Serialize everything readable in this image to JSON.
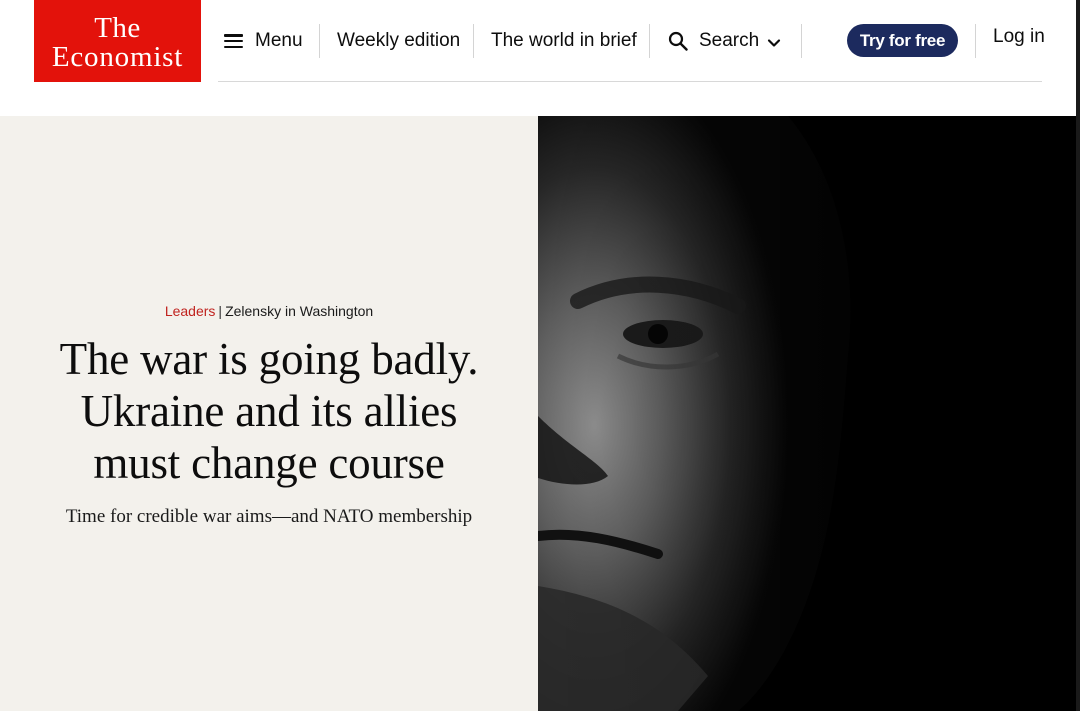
{
  "brand": {
    "logo_line1": "The",
    "logo_line2": "Economist",
    "color": "#e3120b"
  },
  "nav": {
    "menu_label": "Menu",
    "weekly_edition": "Weekly edition",
    "world_in_brief": "The world in brief",
    "search_label": "Search",
    "try_free_label": "Try for free",
    "login_label": "Log in",
    "icons": [
      "menu-icon",
      "search-icon",
      "chevron-down-icon"
    ],
    "cta_color": "#1c2a5e"
  },
  "article": {
    "section": "Leaders",
    "topic": "Zelensky in Washington",
    "headline_line1": "The war is going badly.",
    "headline_line2": "Ukraine and its allies",
    "headline_line3": "must change course",
    "subhead": "Time for credible war aims—and NATO membership",
    "section_color": "#c0231f",
    "panel_color": "#f3f1ec"
  }
}
